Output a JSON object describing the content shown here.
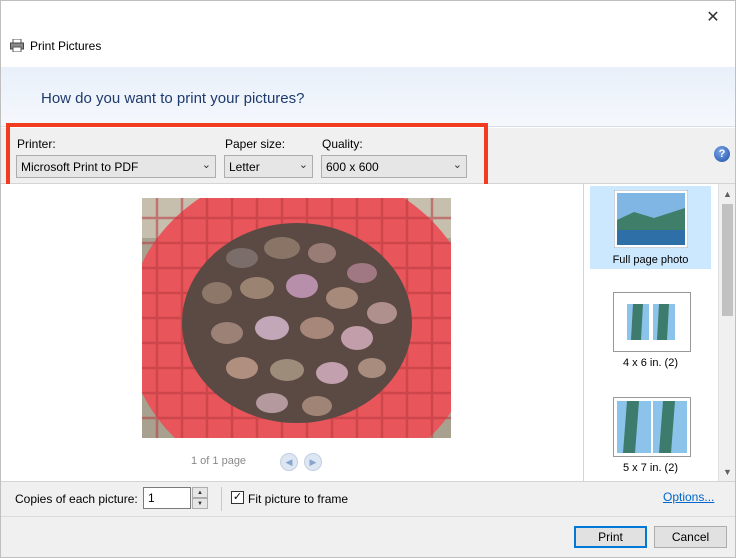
{
  "window": {
    "title": "Print Pictures",
    "close_glyph": "✕",
    "app_icon": "printer-icon"
  },
  "header": {
    "question": "How do you want to print your pictures?"
  },
  "options": {
    "printer_label": "Printer:",
    "printer_value": "Microsoft Print to PDF",
    "paper_label": "Paper size:",
    "paper_value": "Letter",
    "quality_label": "Quality:",
    "quality_value": "600 x 600",
    "help_glyph": "?",
    "highlight_color": "#f13c20"
  },
  "preview": {
    "page_info": "1 of 1 page",
    "prev_glyph": "◀",
    "next_glyph": "▶"
  },
  "layouts": {
    "items": [
      {
        "label": "Full page photo",
        "selected": true
      },
      {
        "label": "4 x 6 in. (2)",
        "selected": false
      },
      {
        "label": "5 x 7 in. (2)",
        "selected": false
      }
    ]
  },
  "bottom": {
    "copies_label": "Copies of each picture:",
    "copies_value": "1",
    "fit_label": "Fit picture to frame",
    "fit_checked": true,
    "options_link": "Options..."
  },
  "buttons": {
    "print": "Print",
    "cancel": "Cancel"
  },
  "colors": {
    "accent": "#0078d7",
    "link": "#0066cc",
    "question_text": "#1f3a6e"
  }
}
